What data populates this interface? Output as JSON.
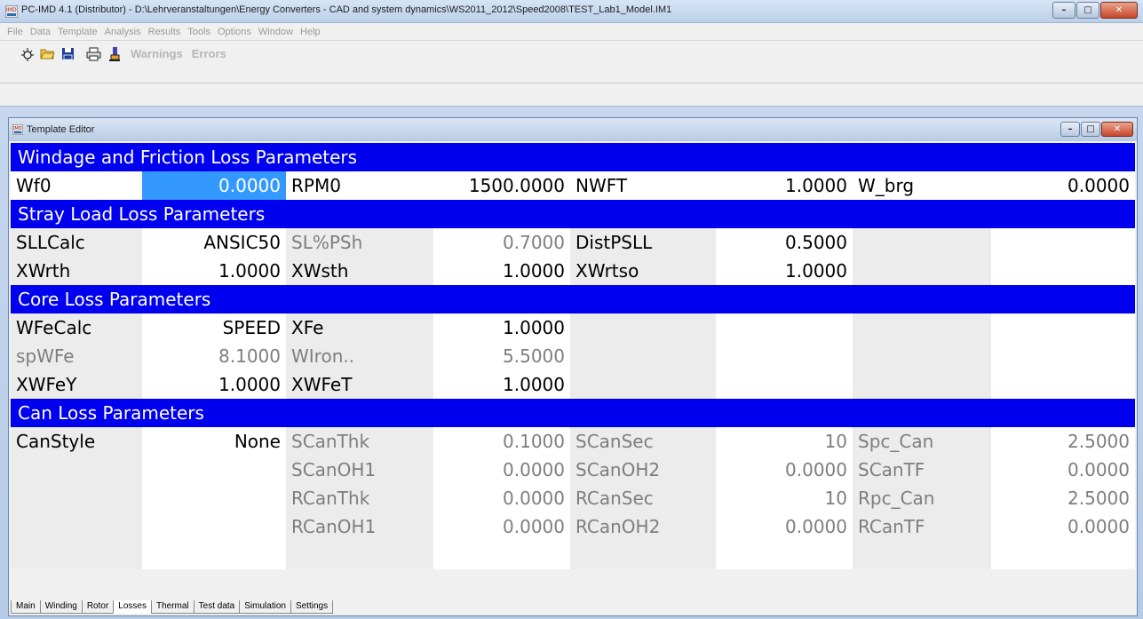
{
  "window": {
    "title": "PC-IMD 4.1 (Distributor) - D:\\Lehrveranstaltungen\\Energy Converters - CAD and system dynamics\\WS2011_2012\\Speed2008\\TEST_Lab1_Model.IM1",
    "minimize": "–",
    "maximize": "□",
    "close": "✕"
  },
  "menu": [
    "File",
    "Data",
    "Template",
    "Analysis",
    "Results",
    "Tools",
    "Options",
    "Window",
    "Help"
  ],
  "toolbar": {
    "warnings": "Warnings",
    "errors": "Errors",
    "icons": [
      "new-icon",
      "open-folder-icon",
      "save-icon",
      "print-icon",
      "run-icon"
    ]
  },
  "child": {
    "title": "Template Editor",
    "minimize": "–",
    "maximize": "□",
    "close": "✕"
  },
  "sections": [
    {
      "header": "Windage and Friction Loss Parameters",
      "rows": [
        [
          {
            "t": "Wf0",
            "tone": "black",
            "bg": "white"
          },
          {
            "t": "0.0000",
            "tone": "selected",
            "bg": "selected"
          },
          {
            "t": "RPM0",
            "tone": "black",
            "bg": "white"
          },
          {
            "t": "1500.0000",
            "tone": "black",
            "bg": "white"
          },
          {
            "t": "NWFT",
            "tone": "black",
            "bg": "white"
          },
          {
            "t": "1.0000",
            "tone": "black",
            "bg": "white"
          },
          {
            "t": "W_brg",
            "tone": "black",
            "bg": "white"
          },
          {
            "t": "0.0000",
            "tone": "black",
            "bg": "white"
          }
        ]
      ]
    },
    {
      "header": "Stray Load Loss Parameters",
      "rows": [
        [
          {
            "t": "SLLCalc",
            "tone": "black",
            "bg": "gray"
          },
          {
            "t": "ANSIC50",
            "tone": "black",
            "bg": "white"
          },
          {
            "t": "SL%PSh",
            "tone": "gray",
            "bg": "gray"
          },
          {
            "t": "0.7000",
            "tone": "gray",
            "bg": "white"
          },
          {
            "t": "DistPSLL",
            "tone": "black",
            "bg": "gray"
          },
          {
            "t": "0.5000",
            "tone": "black",
            "bg": "white"
          },
          {
            "t": "",
            "tone": "black",
            "bg": "gray"
          },
          {
            "t": "",
            "tone": "black",
            "bg": "white"
          }
        ],
        [
          {
            "t": "XWrth",
            "tone": "black",
            "bg": "gray"
          },
          {
            "t": "1.0000",
            "tone": "black",
            "bg": "white"
          },
          {
            "t": "XWsth",
            "tone": "black",
            "bg": "gray"
          },
          {
            "t": "1.0000",
            "tone": "black",
            "bg": "white"
          },
          {
            "t": "XWrtso",
            "tone": "black",
            "bg": "gray"
          },
          {
            "t": "1.0000",
            "tone": "black",
            "bg": "white"
          },
          {
            "t": "",
            "tone": "black",
            "bg": "gray"
          },
          {
            "t": "",
            "tone": "black",
            "bg": "white"
          }
        ]
      ]
    },
    {
      "header": "Core Loss Parameters",
      "rows": [
        [
          {
            "t": "WFeCalc",
            "tone": "black",
            "bg": "gray"
          },
          {
            "t": "SPEED",
            "tone": "black",
            "bg": "white"
          },
          {
            "t": "XFe",
            "tone": "black",
            "bg": "gray"
          },
          {
            "t": "1.0000",
            "tone": "black",
            "bg": "white"
          },
          {
            "t": "",
            "tone": "black",
            "bg": "gray"
          },
          {
            "t": "",
            "tone": "black",
            "bg": "white"
          },
          {
            "t": "",
            "tone": "black",
            "bg": "gray"
          },
          {
            "t": "",
            "tone": "black",
            "bg": "white"
          }
        ],
        [
          {
            "t": "spWFe",
            "tone": "gray",
            "bg": "gray"
          },
          {
            "t": "8.1000",
            "tone": "gray",
            "bg": "white"
          },
          {
            "t": "WIron..",
            "tone": "gray",
            "bg": "gray"
          },
          {
            "t": "5.5000",
            "tone": "gray",
            "bg": "white"
          },
          {
            "t": "",
            "tone": "black",
            "bg": "gray"
          },
          {
            "t": "",
            "tone": "black",
            "bg": "white"
          },
          {
            "t": "",
            "tone": "black",
            "bg": "gray"
          },
          {
            "t": "",
            "tone": "black",
            "bg": "white"
          }
        ],
        [
          {
            "t": "XWFeY",
            "tone": "black",
            "bg": "gray"
          },
          {
            "t": "1.0000",
            "tone": "black",
            "bg": "white"
          },
          {
            "t": "XWFeT",
            "tone": "black",
            "bg": "gray"
          },
          {
            "t": "1.0000",
            "tone": "black",
            "bg": "white"
          },
          {
            "t": "",
            "tone": "black",
            "bg": "gray"
          },
          {
            "t": "",
            "tone": "black",
            "bg": "white"
          },
          {
            "t": "",
            "tone": "black",
            "bg": "gray"
          },
          {
            "t": "",
            "tone": "black",
            "bg": "white"
          }
        ]
      ]
    },
    {
      "header": "Can Loss Parameters",
      "rows": [
        [
          {
            "t": "CanStyle",
            "tone": "black",
            "bg": "gray"
          },
          {
            "t": "None",
            "tone": "black",
            "bg": "white"
          },
          {
            "t": "SCanThk",
            "tone": "gray",
            "bg": "gray"
          },
          {
            "t": "0.1000",
            "tone": "gray",
            "bg": "white"
          },
          {
            "t": "SCanSec",
            "tone": "gray",
            "bg": "gray"
          },
          {
            "t": "10",
            "tone": "gray",
            "bg": "white"
          },
          {
            "t": "Spc_Can",
            "tone": "gray",
            "bg": "gray"
          },
          {
            "t": "2.5000",
            "tone": "gray",
            "bg": "white"
          }
        ],
        [
          {
            "t": "",
            "tone": "black",
            "bg": "gray"
          },
          {
            "t": "",
            "tone": "black",
            "bg": "white"
          },
          {
            "t": "SCanOH1",
            "tone": "gray",
            "bg": "gray"
          },
          {
            "t": "0.0000",
            "tone": "gray",
            "bg": "white"
          },
          {
            "t": "SCanOH2",
            "tone": "gray",
            "bg": "gray"
          },
          {
            "t": "0.0000",
            "tone": "gray",
            "bg": "white"
          },
          {
            "t": "SCanTF",
            "tone": "gray",
            "bg": "gray"
          },
          {
            "t": "0.0000",
            "tone": "gray",
            "bg": "white"
          }
        ],
        [
          {
            "t": "",
            "tone": "black",
            "bg": "gray"
          },
          {
            "t": "",
            "tone": "black",
            "bg": "white"
          },
          {
            "t": "RCanThk",
            "tone": "gray",
            "bg": "gray"
          },
          {
            "t": "0.0000",
            "tone": "gray",
            "bg": "white"
          },
          {
            "t": "RCanSec",
            "tone": "gray",
            "bg": "gray"
          },
          {
            "t": "10",
            "tone": "gray",
            "bg": "white"
          },
          {
            "t": "Rpc_Can",
            "tone": "gray",
            "bg": "gray"
          },
          {
            "t": "2.5000",
            "tone": "gray",
            "bg": "white"
          }
        ],
        [
          {
            "t": "",
            "tone": "black",
            "bg": "gray"
          },
          {
            "t": "",
            "tone": "black",
            "bg": "white"
          },
          {
            "t": "RCanOH1",
            "tone": "gray",
            "bg": "gray"
          },
          {
            "t": "0.0000",
            "tone": "gray",
            "bg": "white"
          },
          {
            "t": "RCanOH2",
            "tone": "gray",
            "bg": "gray"
          },
          {
            "t": "0.0000",
            "tone": "gray",
            "bg": "white"
          },
          {
            "t": "RCanTF",
            "tone": "gray",
            "bg": "gray"
          },
          {
            "t": "0.0000",
            "tone": "gray",
            "bg": "white"
          }
        ],
        [
          {
            "t": "",
            "tone": "black",
            "bg": "gray"
          },
          {
            "t": "",
            "tone": "black",
            "bg": "white"
          },
          {
            "t": "",
            "tone": "black",
            "bg": "gray"
          },
          {
            "t": "",
            "tone": "black",
            "bg": "white"
          },
          {
            "t": "",
            "tone": "black",
            "bg": "gray"
          },
          {
            "t": "",
            "tone": "black",
            "bg": "white"
          },
          {
            "t": "",
            "tone": "black",
            "bg": "gray"
          },
          {
            "t": "",
            "tone": "black",
            "bg": "white"
          }
        ]
      ]
    }
  ],
  "tabs": [
    {
      "label": "Main",
      "active": false
    },
    {
      "label": "Winding",
      "active": false
    },
    {
      "label": "Rotor",
      "active": false
    },
    {
      "label": "Losses",
      "active": true
    },
    {
      "label": "Thermal",
      "active": false
    },
    {
      "label": "Test data",
      "active": false
    },
    {
      "label": "Simulation",
      "active": false
    },
    {
      "label": "Settings",
      "active": false
    }
  ],
  "colors": {
    "header_bg": "#0000ef",
    "selection": "#3399ff",
    "gray_cell": "#ececec",
    "gray_text": "#7e7e7e"
  }
}
